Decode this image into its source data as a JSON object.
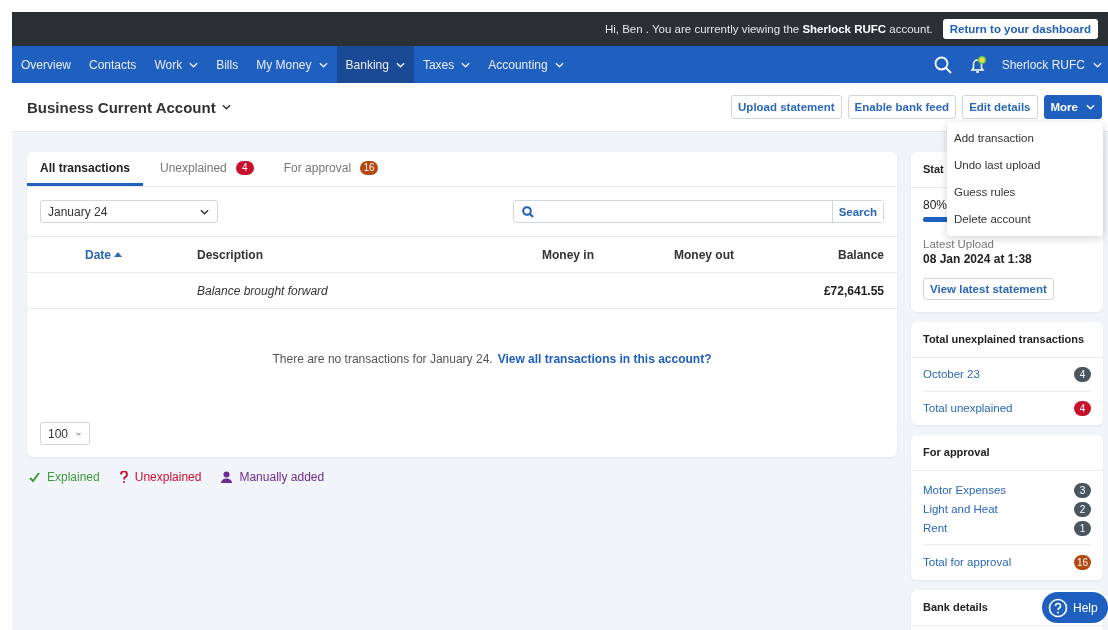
{
  "banner": {
    "greeting": "Hi, Ben . You are currently viewing the **Sherlock RUFC** account.",
    "button": "Return to your dashboard"
  },
  "nav": {
    "items": [
      {
        "label": "Overview",
        "dropdown": false,
        "selected": false
      },
      {
        "label": "Contacts",
        "dropdown": false,
        "selected": false
      },
      {
        "label": "Work",
        "dropdown": true,
        "selected": false
      },
      {
        "label": "Bills",
        "dropdown": false,
        "selected": false
      },
      {
        "label": "My Money",
        "dropdown": true,
        "selected": false
      },
      {
        "label": "Banking",
        "dropdown": true,
        "selected": true
      },
      {
        "label": "Taxes",
        "dropdown": true,
        "selected": false
      },
      {
        "label": "Accounting",
        "dropdown": true,
        "selected": false
      }
    ],
    "account": "Sherlock RUFC"
  },
  "header": {
    "title": "Business Current Account",
    "buttons": [
      {
        "label": "Upload statement",
        "primary": false
      },
      {
        "label": "Enable bank feed",
        "primary": false
      },
      {
        "label": "Edit details",
        "primary": false
      },
      {
        "label": "More",
        "primary": true
      }
    ]
  },
  "menu": [
    "Add transaction",
    "Undo last upload",
    "Guess rules",
    "Delete account"
  ],
  "tabs": [
    {
      "label": "All transactions",
      "selected": true
    },
    {
      "label": "Unexplained",
      "selected": false,
      "badge": "4",
      "color": "#c8102e"
    },
    {
      "label": "For approval",
      "selected": false,
      "badge": "16",
      "color": "#b5480f"
    }
  ],
  "filter": {
    "period": "January 24",
    "search_button": "Search"
  },
  "table": {
    "columns": [
      {
        "label": "Date",
        "sorted": true
      },
      {
        "label": "Description",
        "sorted": false
      },
      {
        "label": "Money in",
        "sorted": false
      },
      {
        "label": "Money out",
        "sorted": false
      },
      {
        "label": "Balance",
        "sorted": false
      }
    ],
    "rows": [
      {
        "description": "Balance brought forward",
        "balance": "£72,641.55"
      }
    ]
  },
  "empty_message": "There are no transactions for January 24.",
  "empty_link": "View all transactions in this account?",
  "page_size": "100",
  "legend": [
    {
      "kind": "explained",
      "label": "Explained",
      "color": "#3c9a3c"
    },
    {
      "kind": "unexplained",
      "label": "Unexplained",
      "color": "#c8102e"
    },
    {
      "kind": "manual",
      "label": "Manually added",
      "color": "#6b2c91"
    }
  ],
  "statements": {
    "title": "Stat",
    "percent": "80%",
    "level": 0.8,
    "latest_label": "Latest Upload",
    "latest_value": "08 Jan 2024 at 1:38",
    "button": "View latest statement"
  },
  "unexplained": {
    "title": "Total unexplained transactions",
    "items": [
      {
        "label": "October 23",
        "count": "4",
        "color": "#4a5560"
      }
    ],
    "total": {
      "label": "Total unexplained",
      "count": "4",
      "color": "#c8102e"
    }
  },
  "approval": {
    "title": "For approval",
    "items": [
      {
        "label": "Motor Expenses",
        "count": "3",
        "color": "#4a5560"
      },
      {
        "label": "Light and Heat",
        "count": "2",
        "color": "#4a5560"
      },
      {
        "label": "Rent",
        "count": "1",
        "color": "#4a5560"
      }
    ],
    "total": {
      "label": "Total for approval",
      "count": "16",
      "color": "#b5480f"
    }
  },
  "bank_details": {
    "title": "Bank details"
  },
  "help": "Help"
}
